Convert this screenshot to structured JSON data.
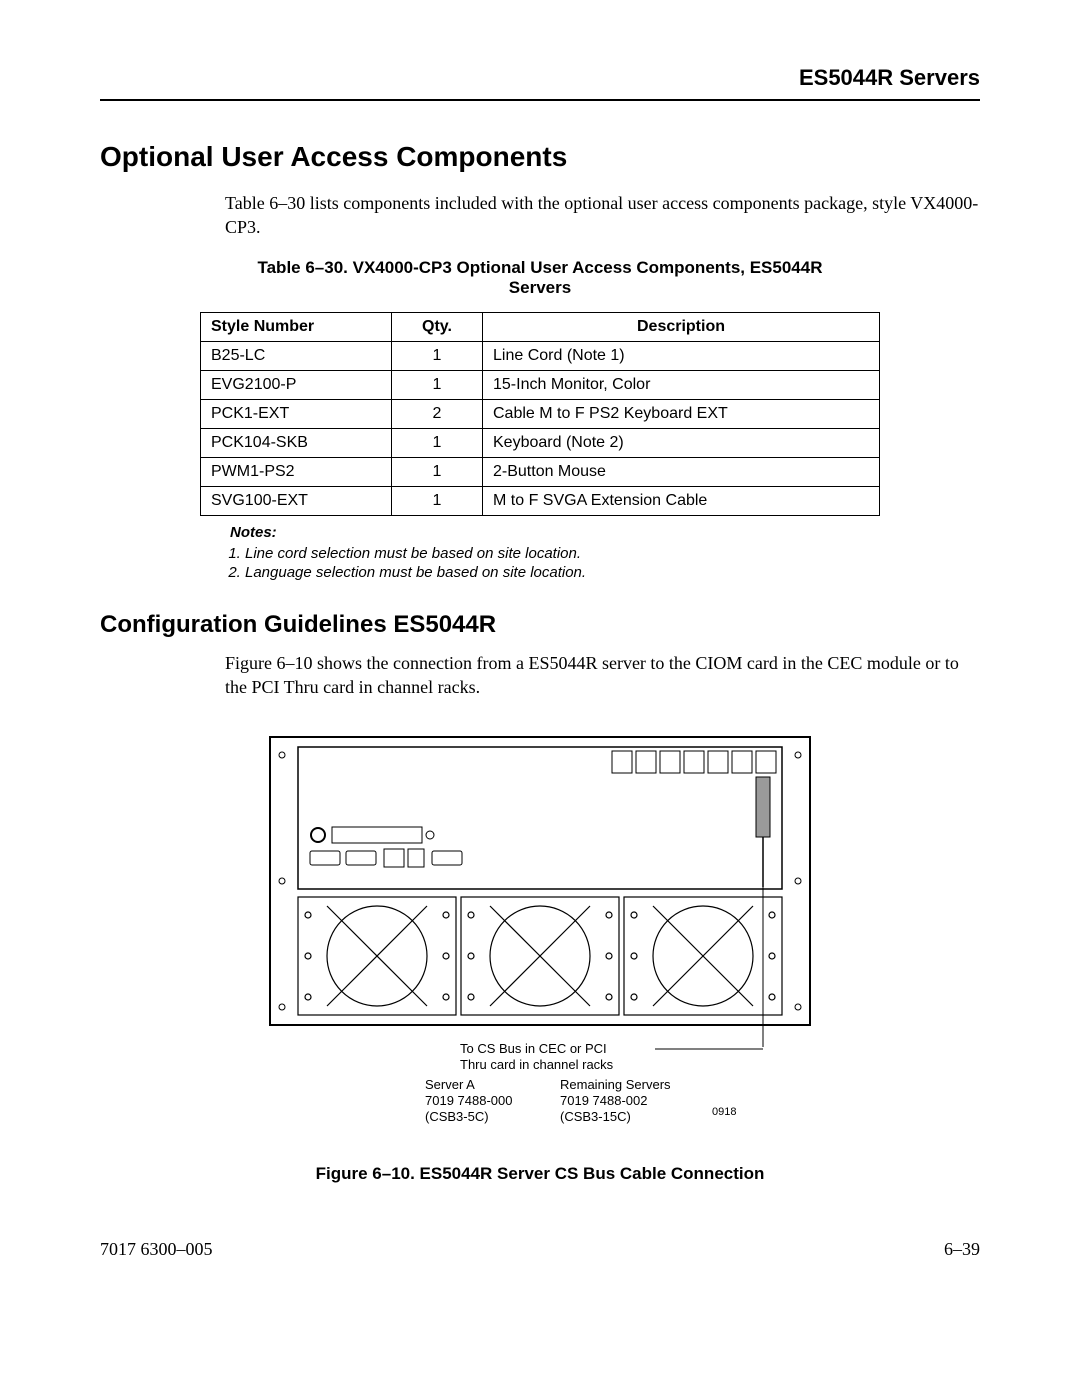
{
  "header": {
    "running_head": "ES5044R Servers"
  },
  "section1": {
    "title": "Optional User Access Components",
    "paragraph": "Table 6–30 lists components included with the optional user access components package, style VX4000-CP3.",
    "table_caption": "Table 6–30.  VX4000-CP3 Optional User Access Components, ES5044R Servers",
    "table": {
      "headers": {
        "style": "Style Number",
        "qty": "Qty.",
        "desc": "Description"
      },
      "rows": [
        {
          "style": "B25-LC",
          "qty": "1",
          "desc": "Line Cord (Note 1)"
        },
        {
          "style": "EVG2100-P",
          "qty": "1",
          "desc": "15-Inch Monitor, Color"
        },
        {
          "style": "PCK1-EXT",
          "qty": "2",
          "desc": "Cable M to F PS2 Keyboard EXT"
        },
        {
          "style": "PCK104-SKB",
          "qty": "1",
          "desc": "Keyboard (Note 2)"
        },
        {
          "style": "PWM1-PS2",
          "qty": "1",
          "desc": "2-Button Mouse"
        },
        {
          "style": "SVG100-EXT",
          "qty": "1",
          "desc": "M to F SVGA Extension Cable"
        }
      ]
    },
    "notes_title": "Notes:",
    "notes": [
      "Line cord selection must be based on site location.",
      "Language selection must be based on site location."
    ]
  },
  "section2": {
    "title": "Configuration Guidelines ES5044R",
    "paragraph": "Figure 6–10 shows the connection from a ES5044R server to the CIOM card in the CEC module or to the PCI Thru card in channel racks.",
    "figure": {
      "label1": "To CS Bus in CEC or PCI",
      "label2": "Thru card in channel racks",
      "colA_h": "Server A",
      "colA_1": "7019 7488-000",
      "colA_2": "(CSB3-5C)",
      "colB_h": "Remaining Servers",
      "colB_1": "7019 7488-002",
      "colB_2": "(CSB3-15C)",
      "dwg_no": "0918",
      "caption": "Figure 6–10.  ES5044R Server CS Bus Cable Connection"
    }
  },
  "footer": {
    "left": "7017 6300–005",
    "right": "6–39"
  }
}
